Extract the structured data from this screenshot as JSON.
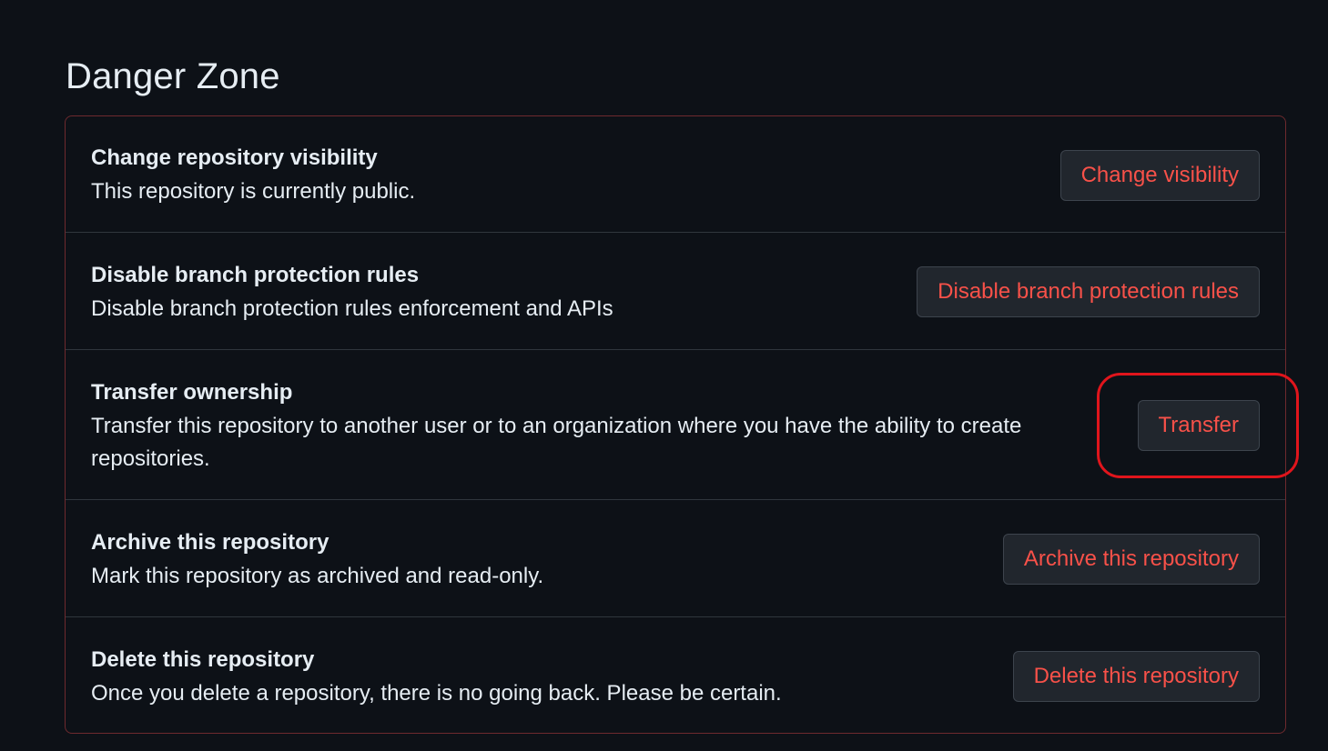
{
  "page": {
    "title": "Danger Zone"
  },
  "colors": {
    "background": "#0d1117",
    "danger_text": "#f85149",
    "box_border": "#6e2a2e",
    "button_bg": "#21262d",
    "highlight": "#e0151c"
  },
  "rows": [
    {
      "title": "Change repository visibility",
      "description": "This repository is currently public.",
      "button_label": "Change visibility"
    },
    {
      "title": "Disable branch protection rules",
      "description": "Disable branch protection rules enforcement and APIs",
      "button_label": "Disable branch protection rules"
    },
    {
      "title": "Transfer ownership",
      "description": "Transfer this repository to another user or to an organization where you have the ability to create repositories.",
      "button_label": "Transfer"
    },
    {
      "title": "Archive this repository",
      "description": "Mark this repository as archived and read-only.",
      "button_label": "Archive this repository"
    },
    {
      "title": "Delete this repository",
      "description": "Once you delete a repository, there is no going back. Please be certain.",
      "button_label": "Delete this repository"
    }
  ]
}
